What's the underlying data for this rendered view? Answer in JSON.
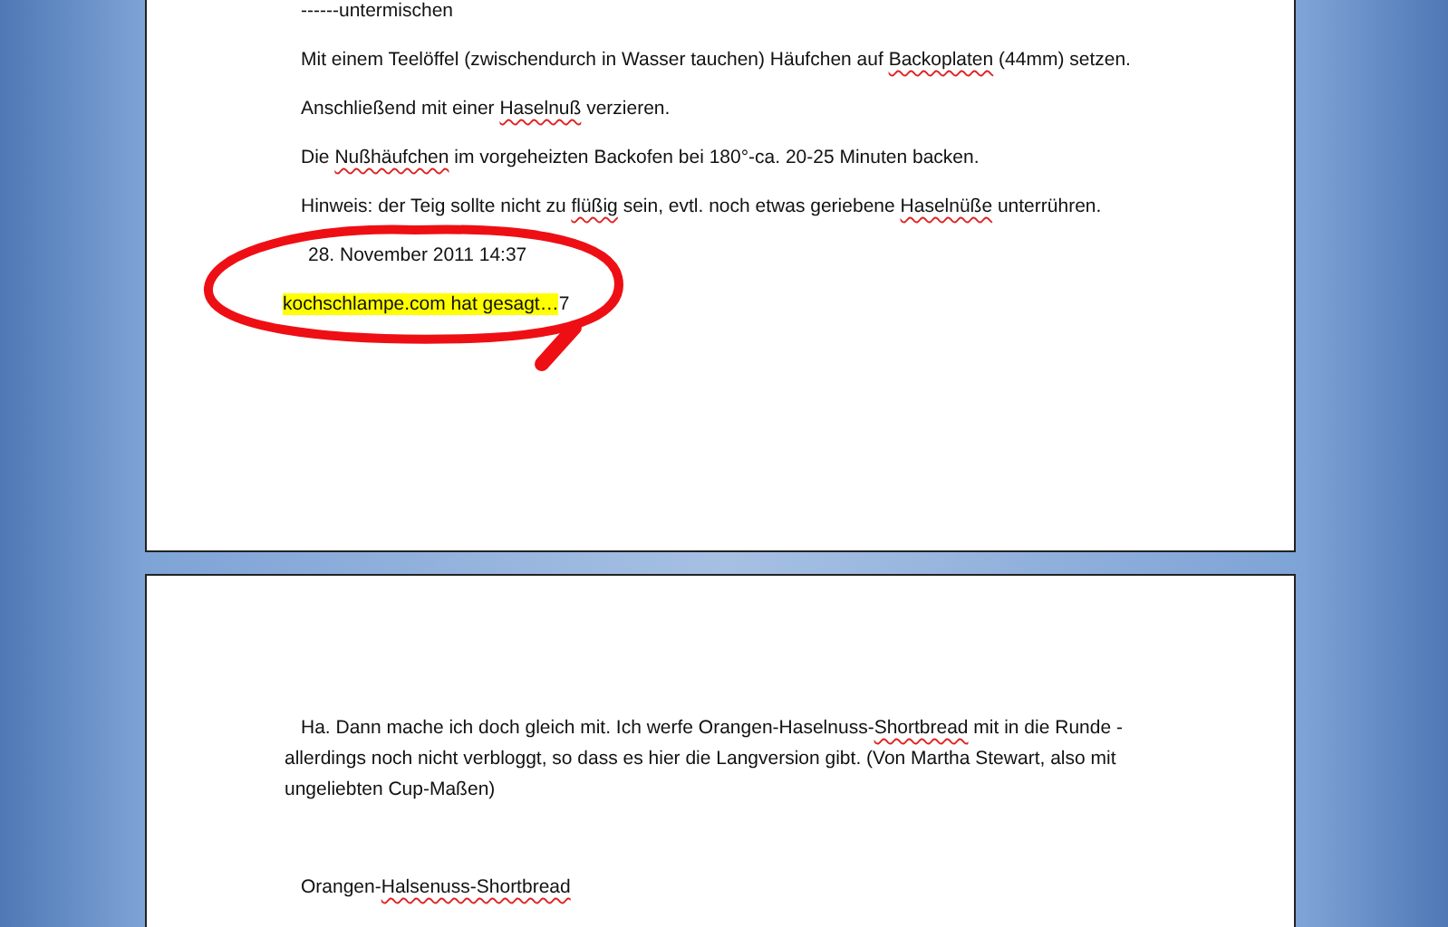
{
  "pages": [
    {
      "kind": "upper",
      "paragraphs": [
        {
          "kind": "body",
          "segments": [
            {
              "text": "------untermischen",
              "spelling_error": false,
              "highlight": false
            }
          ]
        },
        {
          "kind": "body",
          "segments": [
            {
              "text": "Mit einem Teelöffel (zwischendurch in Wasser tauchen) Häufchen auf ",
              "spelling_error": false,
              "highlight": false
            },
            {
              "text": "Backoplaten",
              "spelling_error": true,
              "highlight": false
            },
            {
              "text": " (44mm) setzen.",
              "spelling_error": false,
              "highlight": false
            }
          ]
        },
        {
          "kind": "body",
          "segments": [
            {
              "text": "Anschließend mit einer ",
              "spelling_error": false,
              "highlight": false
            },
            {
              "text": "Haselnuß",
              "spelling_error": true,
              "highlight": false
            },
            {
              "text": " verzieren.",
              "spelling_error": false,
              "highlight": false
            }
          ]
        },
        {
          "kind": "body",
          "segments": [
            {
              "text": "Die ",
              "spelling_error": false,
              "highlight": false
            },
            {
              "text": "Nußhäufchen",
              "spelling_error": true,
              "highlight": false
            },
            {
              "text": " im vorgeheizten Backofen bei 180°-ca. 20-25  Minuten backen.",
              "spelling_error": false,
              "highlight": false
            }
          ]
        },
        {
          "kind": "body",
          "segments": [
            {
              "text": "Hinweis: der Teig sollte nicht zu ",
              "spelling_error": false,
              "highlight": false
            },
            {
              "text": "flüßig",
              "spelling_error": true,
              "highlight": false
            },
            {
              "text": " sein, evtl. noch etwas geriebene ",
              "spelling_error": false,
              "highlight": false
            },
            {
              "text": "Haselnüße",
              "spelling_error": true,
              "highlight": false
            },
            {
              "text": " unterrühren.",
              "spelling_error": false,
              "highlight": false
            }
          ]
        },
        {
          "kind": "date",
          "segments": [
            {
              "text": "28. November 2011 14:37",
              "spelling_error": false,
              "highlight": false
            }
          ]
        },
        {
          "kind": "comment",
          "segments": [
            {
              "text": "kochschlampe.com hat gesagt…",
              "spelling_error": false,
              "highlight": true
            },
            {
              "text": "7",
              "spelling_error": false,
              "highlight": false
            }
          ]
        }
      ]
    },
    {
      "kind": "lower",
      "paragraphs": [
        {
          "kind": "intro",
          "segments": [
            {
              "text": "Ha. Dann mache ich doch gleich mit. Ich werfe Orangen-Haselnuss-",
              "spelling_error": false,
              "highlight": false
            },
            {
              "text": "Shortbread",
              "spelling_error": true,
              "highlight": false
            },
            {
              "text": " mit in die Runde - allerdings noch nicht verbloggt, so dass es hier die Langversion gibt. (Von Martha Stewart, also mit ungeliebten Cup-Maßen)",
              "spelling_error": false,
              "highlight": false
            }
          ]
        },
        {
          "kind": "heading",
          "segments": [
            {
              "text": "Orangen-",
              "spelling_error": false,
              "highlight": false
            },
            {
              "text": "Halsenuss-Shortbread",
              "spelling_error": true,
              "highlight": false
            }
          ]
        }
      ]
    }
  ]
}
